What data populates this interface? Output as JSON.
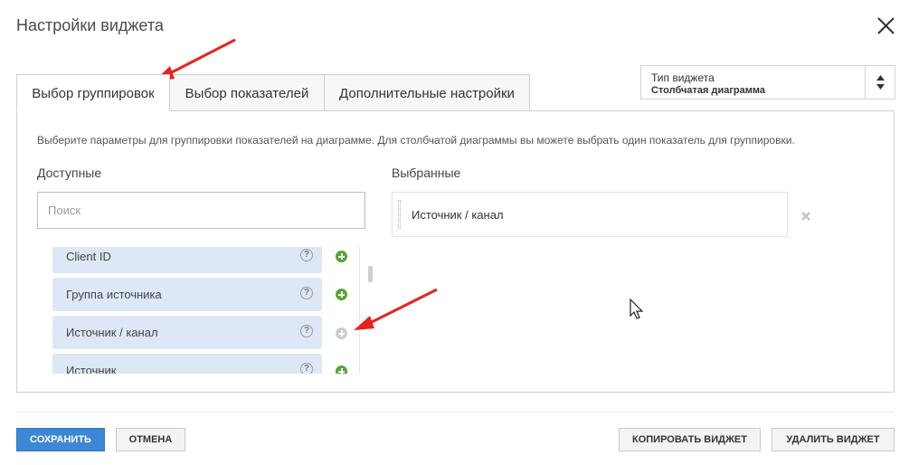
{
  "dialog": {
    "title": "Настройки виджета",
    "close_icon": "close-icon"
  },
  "widget_type": {
    "label": "Тип виджета",
    "value": "Столбчатая диаграмма",
    "icon": "sort-arrows-icon"
  },
  "tabs": [
    {
      "label": "Выбор группировок",
      "active": true
    },
    {
      "label": "Выбор показателей",
      "active": false
    },
    {
      "label": "Дополнительные настройки",
      "active": false
    }
  ],
  "panel": {
    "hint": "Выберите параметры для группировки показателей на диаграмме. Для столбчатой диаграммы вы можете выбрать один показатель для группировки.",
    "available_label": "Доступные",
    "selected_label": "Выбранные",
    "search_placeholder": "Поиск",
    "available_items": [
      {
        "label": "Client ID",
        "addable": true
      },
      {
        "label": "Группа источника",
        "addable": true
      },
      {
        "label": "Источник / канал",
        "addable": false
      },
      {
        "label": "Источник",
        "addable": true
      }
    ],
    "selected_items": [
      {
        "label": "Источник / канал"
      }
    ],
    "help_glyph": "?"
  },
  "footer": {
    "save": "СОХРАНИТЬ",
    "cancel": "ОТМЕНА",
    "copy": "КОПИРОВАТЬ ВИДЖЕТ",
    "delete": "УДАЛИТЬ ВИДЖЕТ"
  },
  "colors": {
    "primary": "#3d87d4",
    "item_bg": "#dde8f6",
    "add_green": "#5aa236",
    "annotation_red": "#e8231f"
  }
}
